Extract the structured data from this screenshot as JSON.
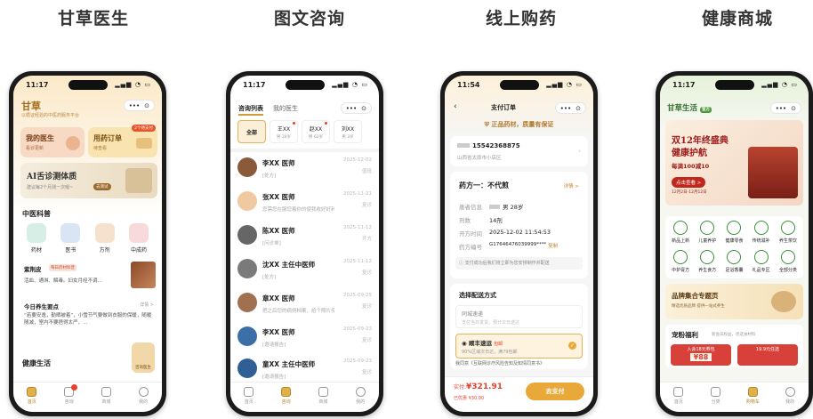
{
  "columns": [
    "甘草医生",
    "图文咨询",
    "线上购药",
    "健康商城"
  ],
  "status_time": [
    "11:17",
    "11:17",
    "11:54",
    "11:17"
  ],
  "status_icons": "▂▄▆ ◔ ▭",
  "phone1": {
    "brand": "甘草",
    "subtitle": "以循证经验的中医药服务平台",
    "my_doctor": {
      "title": "我的医生",
      "sub": "看诊更新"
    },
    "orders": {
      "title": "用药订单",
      "sub": "待查看",
      "badge": "2个待支付"
    },
    "ai": {
      "title": "AI舌诊测体质",
      "sub": "建议每2个月测一次喔~",
      "btn": "去测试"
    },
    "section": "中医科普",
    "kepu": [
      "药材",
      "医书",
      "方剂",
      "中成药"
    ],
    "herb": {
      "name": "紫荆皮",
      "tag": "每日药材科普",
      "desc": "活血、通淋、解毒。妇女月经不调..."
    },
    "tips": {
      "title": "今日养生要点",
      "more": "详情 >",
      "text": "“若要安逸，勤晒被着”，小雪节气要做到衣服的保暖，随暖随减，室内不要捂得太严，..."
    },
    "life": "健康生活",
    "float": "咨询医生",
    "tabs": [
      "首页",
      "咨询",
      "商城",
      "我的"
    ]
  },
  "phone2": {
    "tab_active": "咨询列表",
    "tab_other": "我的医生",
    "chips": [
      {
        "label": "全部",
        "sub": ""
      },
      {
        "label": "王XX",
        "sub": "男 28岁"
      },
      {
        "label": "赵XX",
        "sub": "男 62岁"
      },
      {
        "label": "刘XX",
        "sub": "男 3岁"
      }
    ],
    "doctors": [
      {
        "name": "李XX  医师",
        "sub": "[处方]",
        "date": "2025-12-02",
        "tag": "值班"
      },
      {
        "name": "张XX  医师",
        "sub": "您需您在服您着你的使我收好好利...",
        "date": "2025-11-21",
        "tag": "复诊"
      },
      {
        "name": "陈XX  医师",
        "sub": "[问诊单]",
        "date": "2025-11-12",
        "tag": "开方"
      },
      {
        "name": "沈XX  主任中医师",
        "sub": "[处方]",
        "date": "2025-11-12",
        "tag": "复诊"
      },
      {
        "name": "章XX  医师",
        "sub": "把之后您的病例档案，给个照片传...",
        "date": "2025-09-25",
        "tag": "复诊"
      },
      {
        "name": "李XX  医师",
        "sub": "[邀请报告]",
        "date": "2025-09-23",
        "tag": "复诊"
      },
      {
        "name": "童XX  主任中医师",
        "sub": "[邀请报告]",
        "date": "2025-09-23",
        "tag": "复诊"
      }
    ],
    "tabs": [
      "首页",
      "咨询",
      "商城",
      "我的"
    ]
  },
  "phone3": {
    "title": "支付订单",
    "banner": "正品药材，质量有保证",
    "phone": "15542368875",
    "address": "山西省太原市小店区",
    "rx_title": "药方一：不代煎",
    "rx_more": "详情 >",
    "rows": [
      {
        "k": "患者信息",
        "v": "男 28岁"
      },
      {
        "k": "剂数",
        "v": "14剂"
      },
      {
        "k": "开方时间",
        "v": "2025-12-02 11:54:53"
      },
      {
        "k": "药方编号",
        "v": "G17646476039999****",
        "extra": "复制"
      }
    ],
    "note": "支付成功后我们将立即为您安排制作并配送",
    "ship_title": "选择配送方式",
    "ship1": {
      "name": "同城速递",
      "sub": "支付当日发货，预计次日送达"
    },
    "ship2": {
      "name": "顺丰速运",
      "tag": "包邮",
      "sub": "90%区域次日达，满79包邮"
    },
    "agree": "我同意《互联网诊疗风险告知及知情同意书》",
    "total_label": "实付:",
    "total": "¥321.91",
    "saved": "已优惠 ¥30.00",
    "pay_btn": "去支付"
  },
  "phone4": {
    "brand": "甘草生活",
    "badge": "官方",
    "promo_title1": "双12年终盛典",
    "promo_title2": "健康护航",
    "promo_sub": "每满100减10",
    "promo_btn": "点击查看 >",
    "promo_date": "12月2日-12月12日",
    "cats": [
      "新品上新",
      "儿童养护",
      "健康零食",
      "传统滋补",
      "养生茶饮",
      "中护膏方",
      "养生食方",
      "足浴香囊",
      "礼品专区",
      "全部分类"
    ],
    "brand_title": "品牌集合专题页",
    "brand_sub": "精选优质品牌 提供一站式养生",
    "welfare_title": "宠粉福利",
    "welfare_sub": "新会员权益，优选食材料",
    "coupon1": "入会18元券包",
    "coupon1_val": "¥88",
    "coupon2": "19.9元任选",
    "tabs": [
      "首页",
      "分类",
      "购物车",
      "我的"
    ]
  }
}
